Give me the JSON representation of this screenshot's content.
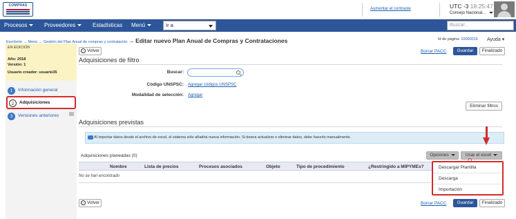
{
  "header": {
    "logo_text": "COMPRAS",
    "contrast_link": "Aumentar el contraste",
    "timezone": "UTC -3",
    "time": "18:25:47",
    "org": "Consejo Nacional..."
  },
  "nav": {
    "items": [
      {
        "label": "Procesos"
      },
      {
        "label": "Proveedores"
      },
      {
        "label": "Estadísticas"
      },
      {
        "label": "Menú"
      }
    ],
    "goto_value": "Ir a",
    "search_placeholder": "Buscar..."
  },
  "breadcrumb": {
    "items": [
      "Escritorio",
      "Menú",
      "Gestión del Plan Anual de compras y contratación"
    ],
    "title": "Editar nuevo Plan Anual de Compras y Contrataciones"
  },
  "page_meta": {
    "id_label": "Id de página:",
    "id_value": "10000016",
    "help": "Ayuda"
  },
  "sidebar": {
    "status": "EN EDICIÓN",
    "year": "Año: 2018",
    "version": "Versión: 1",
    "creator": "Usuario creador: usuario35",
    "steps": [
      {
        "num": "1",
        "label": "Información general"
      },
      {
        "num": "2",
        "label": "Adquisiciones"
      },
      {
        "num": "3",
        "label": "Versiones anteriores"
      }
    ]
  },
  "actions": {
    "back": "Volver",
    "delete_pacc": "Borrar PACC",
    "save": "Guardar",
    "finish": "Finalizado"
  },
  "filter": {
    "title": "Adquisiciones de filtro",
    "search_label": "Buscar:",
    "unspsc_label": "Código UNSPSC:",
    "unspsc_link": "Agregar códigos UNSPSC",
    "mode_label": "Modalidad de selección:",
    "mode_link": "Agregar",
    "clear_button": "Eliminar filtros"
  },
  "planned": {
    "title": "Adquisiciones previstas",
    "info": "Al importar datos desde el archivo de excel, el sistema sólo añadirá nueva información. Si desea actualizar o eliminar datos, debe hacerlo manualmente.",
    "count_label": "Adquisiciones planeadas (0)",
    "options_button": "Opciones",
    "excel_button": "Usar el excel",
    "columns": [
      "Nombre",
      "Lista de precios",
      "Procesos asociados",
      "Objeto",
      "Tipo de procedimiento",
      "¿Restringido a MIPYMEs?"
    ],
    "empty": "No se han encontrado",
    "excel_menu": [
      "Descargar Plantilla",
      "Descarga",
      "Importación"
    ]
  },
  "annotation": {
    "mark": "O",
    "color": "#d42b2b"
  },
  "colors": {
    "brand": "#2c5699",
    "highlight": "#d42b2b",
    "edit_bg": "#fbf3c4"
  }
}
